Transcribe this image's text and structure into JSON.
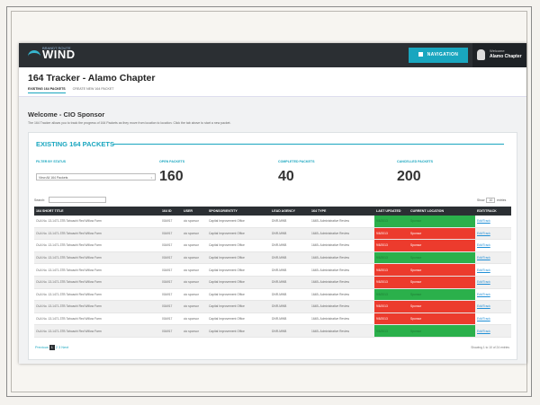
{
  "app": {
    "logo_small": "BRANDT ROUTE",
    "logo_text": "WIND",
    "nav_button": "NAVIGATION",
    "welcome_small": "Welcome",
    "user_name": "Alamo Chapter"
  },
  "page": {
    "title": "164 Tracker - Alamo Chapter",
    "tabs": [
      "EXISTING 164 PACKETS",
      "CREATE NEW 164 PACKET"
    ],
    "welcome": "Welcome - CIO Sponsor",
    "intro": "The 164 Tracker allows you to track the progress of 164 Packets as they move from location to location. Click the tab above to start a new packet."
  },
  "panel": {
    "section_title": "EXISTING 164 PACKETS",
    "filter_label": "FILTER BY STATUS",
    "filter_value": "View All 164 Packets",
    "stats": [
      {
        "label": "OPEN PACKETS",
        "value": "160"
      },
      {
        "label": "COMPLETED PACKETS",
        "value": "40"
      },
      {
        "label": "CANCELLED PACKETS",
        "value": "200"
      }
    ],
    "search_label": "Search:",
    "show_label": "Show",
    "show_value": "10",
    "show_suffix": "entries"
  },
  "table": {
    "headers": [
      "164 SHORT TITLE",
      "164 ID",
      "USER",
      "SPONSOR/ENTITY",
      "LEAD AGENCY",
      "164 TYPE",
      "LAST UPDATED",
      "CURRENT LOCATION",
      "EDIT/TRACK"
    ],
    "rows": [
      {
        "title": "OLA No. 13-1471-3TB Tahoachi Red Willow Farm",
        "id": "00A917",
        "user": "cio sponsor",
        "sponsor": "Capital Improvement Office",
        "agency": "DNR-MWB",
        "type": "164B- Administrative Review",
        "updated": "9/8/2013",
        "location": "Sponsor",
        "status": "green",
        "edit": "Edit/Track"
      },
      {
        "title": "OLA No. 13-1471-3TB Tahoachi Red Willow Farm",
        "id": "00A917",
        "user": "cio sponsor",
        "sponsor": "Capital Improvement Office",
        "agency": "DNR-MWB",
        "type": "164B- Administrative Review",
        "updated": "9/8/2013",
        "location": "Sponsor",
        "status": "red",
        "edit": "Edit/Track"
      },
      {
        "title": "OLA No. 13-1471-3TB Tahoachi Red Willow Farm",
        "id": "00A917",
        "user": "cio sponsor",
        "sponsor": "Capital Improvement Office",
        "agency": "DNR-MWB",
        "type": "164B- Administrative Review",
        "updated": "9/8/2013",
        "location": "Sponsor",
        "status": "red",
        "edit": "Edit/Track"
      },
      {
        "title": "OLA No. 13-1471-3TB Tahoachi Red Willow Farm",
        "id": "00A917",
        "user": "cio sponsor",
        "sponsor": "Capital Improvement Office",
        "agency": "DNR-MWB",
        "type": "164B- Administrative Review",
        "updated": "9/8/2013",
        "location": "Sponsor",
        "status": "green",
        "edit": "Edit/Track"
      },
      {
        "title": "OLA No. 13-1471-3TB Tahoachi Red Willow Farm",
        "id": "00A917",
        "user": "cio sponsor",
        "sponsor": "Capital Improvement Office",
        "agency": "DNR-MWB",
        "type": "164B- Administrative Review",
        "updated": "9/8/2013",
        "location": "Sponsor",
        "status": "red",
        "edit": "Edit/Track"
      },
      {
        "title": "OLA No. 13-1471-3TB Tahoachi Red Willow Farm",
        "id": "00A917",
        "user": "cio sponsor",
        "sponsor": "Capital Improvement Office",
        "agency": "DNR-MWB",
        "type": "164B- Administrative Review",
        "updated": "9/8/2013",
        "location": "Sponsor",
        "status": "red",
        "edit": "Edit/Track"
      },
      {
        "title": "OLA No. 13-1471-3TB Tahoachi Red Willow Farm",
        "id": "00A917",
        "user": "cio sponsor",
        "sponsor": "Capital Improvement Office",
        "agency": "DNR-MWB",
        "type": "164B- Administrative Review",
        "updated": "9/8/2013",
        "location": "Sponsor",
        "status": "green",
        "edit": "Edit/Track"
      },
      {
        "title": "OLA No. 13-1471-3TB Tahoachi Red Willow Farm",
        "id": "00A917",
        "user": "cio sponsor",
        "sponsor": "Capital Improvement Office",
        "agency": "DNR-MWB",
        "type": "164B- Administrative Review",
        "updated": "9/8/2013",
        "location": "Sponsor",
        "status": "red",
        "edit": "Edit/Track"
      },
      {
        "title": "OLA No. 13-1471-3TB Tahoachi Red Willow Farm",
        "id": "00A917",
        "user": "cio sponsor",
        "sponsor": "Capital Improvement Office",
        "agency": "DNR-MWB",
        "type": "164B- Administrative Review",
        "updated": "9/8/2013",
        "location": "Sponsor",
        "status": "red",
        "edit": "Edit/Track"
      },
      {
        "title": "OLA No. 13-1471-3TB Tahoachi Red Willow Farm",
        "id": "00A917",
        "user": "cio sponsor",
        "sponsor": "Capital Improvement Office",
        "agency": "DNR-MWB",
        "type": "164B- Administrative Review",
        "updated": "9/8/2013",
        "location": "Sponsor",
        "status": "green",
        "edit": "Edit/Track"
      }
    ]
  },
  "pager": {
    "previous": "Previous",
    "pages": [
      "1",
      "2",
      "3"
    ],
    "next": "Next",
    "showing": "Showing 1 to 10 of 24 entries"
  },
  "colors": {
    "accent": "#19a6bf",
    "dark": "#2b2f33",
    "status_green": "#2bb04b",
    "status_red": "#ec3b2d"
  }
}
